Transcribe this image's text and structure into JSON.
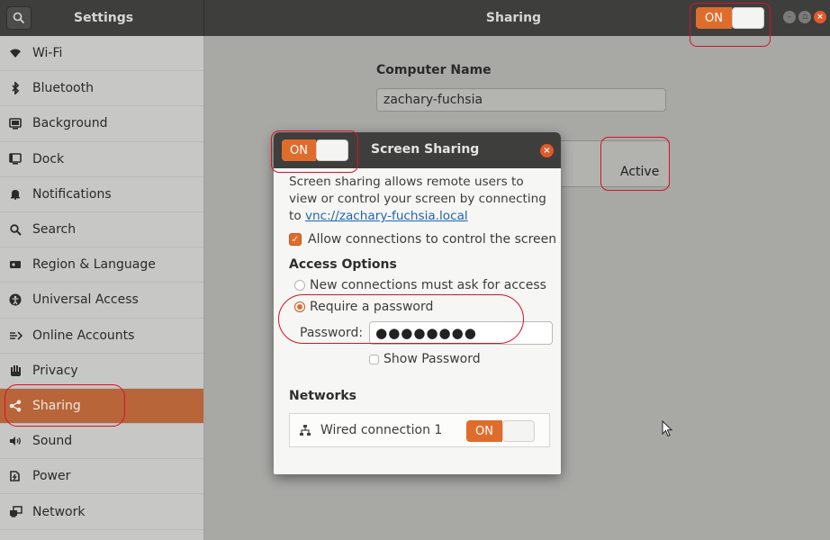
{
  "header": {
    "left_title": "Settings",
    "center_title": "Sharing",
    "main_switch_label": "ON"
  },
  "sidebar": {
    "items": [
      {
        "label": "Wi-Fi",
        "icon": "wifi-icon"
      },
      {
        "label": "Bluetooth",
        "icon": "bluetooth-icon"
      },
      {
        "label": "Background",
        "icon": "background-icon"
      },
      {
        "label": "Dock",
        "icon": "dock-icon"
      },
      {
        "label": "Notifications",
        "icon": "bell-icon"
      },
      {
        "label": "Search",
        "icon": "search-icon"
      },
      {
        "label": "Region & Language",
        "icon": "region-icon"
      },
      {
        "label": "Universal Access",
        "icon": "accessibility-icon"
      },
      {
        "label": "Online Accounts",
        "icon": "online-accounts-icon"
      },
      {
        "label": "Privacy",
        "icon": "hand-icon"
      },
      {
        "label": "Sharing",
        "icon": "share-icon",
        "active": true
      },
      {
        "label": "Sound",
        "icon": "speaker-icon"
      },
      {
        "label": "Power",
        "icon": "power-icon"
      },
      {
        "label": "Network",
        "icon": "network-icon"
      }
    ]
  },
  "main": {
    "computer_name_label": "Computer Name",
    "computer_name_value": "zachary-fuchsia",
    "status_label": "Active"
  },
  "dialog": {
    "title": "Screen Sharing",
    "switch_label": "ON",
    "description_prefix": "Screen sharing allows remote users to view or control your screen by connecting to ",
    "vnc_link": "vnc://zachary-fuchsia.local",
    "allow_control_label": "Allow connections to control the screen",
    "allow_control_checked": true,
    "access_options_heading": "Access Options",
    "option_ask": "New connections must ask for access",
    "option_password": "Require a password",
    "selected_option": "password",
    "password_label": "Password:",
    "password_value": "●●●●●●●●",
    "show_password_label": "Show Password",
    "networks_heading": "Networks",
    "network_name": "Wired connection 1",
    "network_switch_label": "ON"
  },
  "colors": {
    "accent": "#e06c2c",
    "annotation": "#d8112a",
    "headerbar": "#3e3e3c"
  }
}
